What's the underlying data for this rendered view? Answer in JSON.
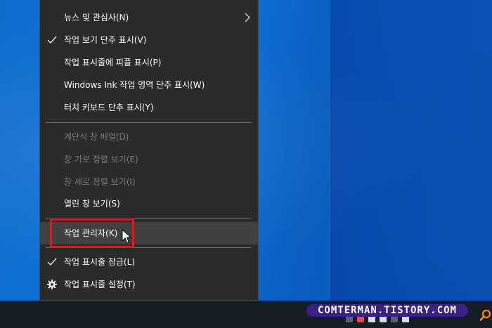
{
  "menu": {
    "items": [
      {
        "label": "뉴스 및 관심사(N)",
        "submenu": true
      },
      {
        "label": "작업 보기 단추 표시(V)",
        "checked": true
      },
      {
        "label": "작업 표시줄에 피플 표시(P)"
      },
      {
        "label": "Windows Ink 작업 영역 단추 표시(W)"
      },
      {
        "label": "터치 키보드 단추 표시(Y)"
      },
      {
        "label": "계단식 창 배열(D)",
        "disabled": true
      },
      {
        "label": "창 가로 정렬 보기(E)",
        "disabled": true
      },
      {
        "label": "창 세로 정렬 보기(I)",
        "disabled": true
      },
      {
        "label": "열린 창 보기(S)"
      },
      {
        "label": "작업 관리자(K)",
        "highlighted": true
      },
      {
        "label": "작업 표시줄 잠금(L)",
        "checked": true
      },
      {
        "label": "작업 표시줄 설정(T)",
        "icon": "gear-icon"
      }
    ]
  },
  "watermark": {
    "text": "COMTERMAN.TISTORY.COM"
  },
  "colors": {
    "menu_bg": "#2b2b2b",
    "highlight_bg": "#414141",
    "disabled_text": "#7a7a7a",
    "callout_red": "#e8141b",
    "desktop_blue": "#0f76d8",
    "taskbar": "#161d24"
  }
}
